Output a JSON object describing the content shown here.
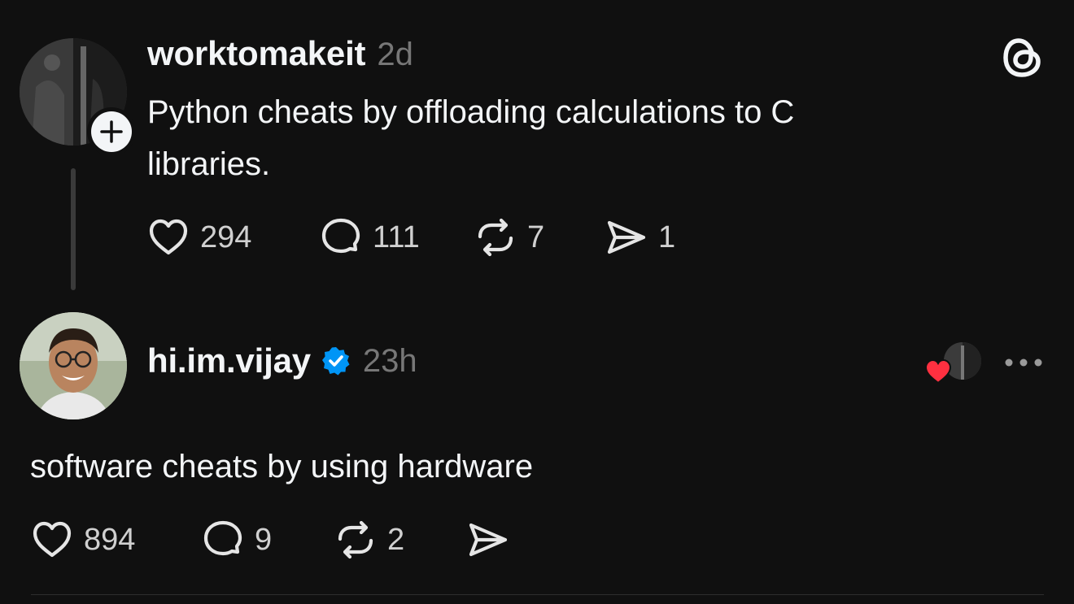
{
  "posts": [
    {
      "username": "worktomakeit",
      "timestamp": "2d",
      "text_line1": "Python cheats by offloading calculations to C",
      "text_line2": "libraries.",
      "likes": "294",
      "replies": "111",
      "reposts": "7",
      "shares": "1",
      "follow_icon": "plus-icon"
    },
    {
      "username": "hi.im.vijay",
      "verified": true,
      "timestamp": "23h",
      "text": "software cheats by using hardware",
      "likes": "894",
      "replies": "9",
      "reposts": "2",
      "liked_by_author_icon": "heart-icon"
    }
  ],
  "app_icon": "threads-logo",
  "colors": {
    "background": "#101010",
    "text": "#f3f5f7",
    "muted": "#777777",
    "verified": "#0095f6",
    "like_red": "#ff3040"
  }
}
